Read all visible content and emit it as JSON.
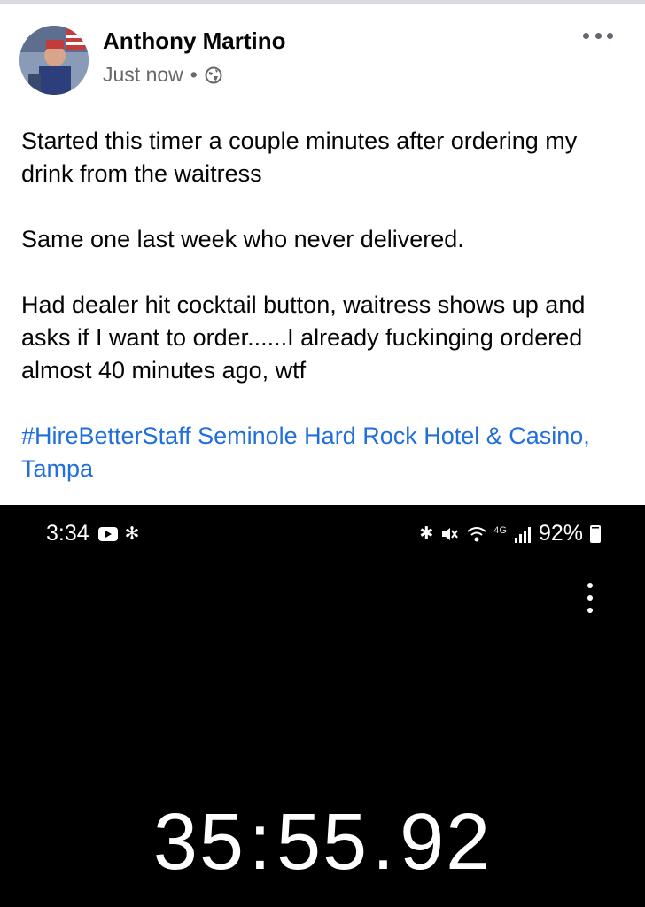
{
  "post": {
    "author": "Anthony Martino",
    "time": "Just now",
    "separator": "•",
    "paragraphs": [
      "Started this timer a couple minutes after ordering my drink from the waitress",
      "Same one last week who never delivered.",
      "Had dealer hit cocktail button, waitress shows up and asks if I want to order......I already fuckinging ordered almost 40 minutes ago, wtf"
    ],
    "hashtag": "#HireBetterStaff",
    "location": " Seminole Hard Rock Hotel & Casino, Tampa",
    "link_color": "#216fdb"
  },
  "phone": {
    "status_time": "3:34",
    "battery": "92%",
    "icons": [
      "youtube-icon",
      "fan-icon",
      "bluetooth-icon",
      "mute-icon",
      "wifi-icon",
      "signal-icon",
      "battery-icon",
      "kebab-menu-icon"
    ],
    "lte_label": "4G",
    "timer": {
      "minutes": "35",
      "seconds": "55",
      "hundredths": "92",
      "sep1": ":",
      "sep2": "."
    }
  }
}
